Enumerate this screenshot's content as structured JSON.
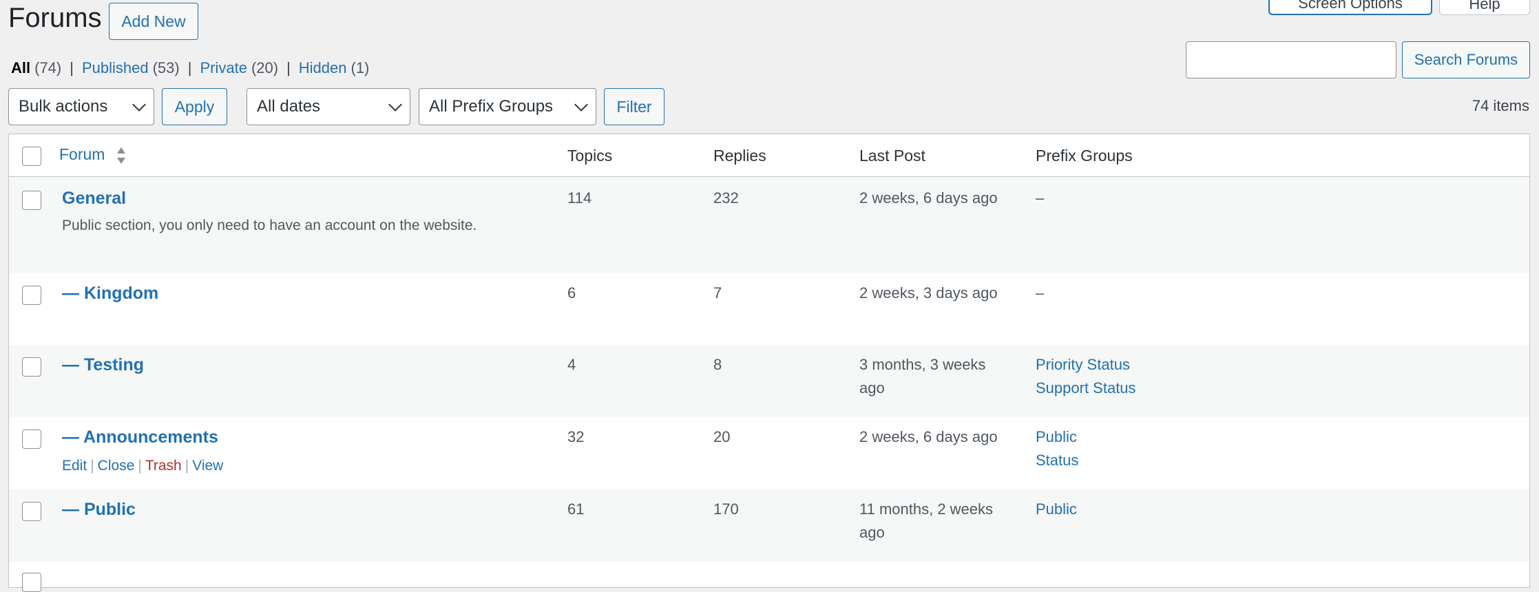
{
  "header": {
    "title": "Forums",
    "add_new": "Add New",
    "screen_options": "Screen Options",
    "help": "Help"
  },
  "views": [
    {
      "label": "All",
      "count": "(74)"
    },
    {
      "label": "Published",
      "count": "(53)"
    },
    {
      "label": "Private",
      "count": "(20)"
    },
    {
      "label": "Hidden",
      "count": "(1)"
    }
  ],
  "search": {
    "placeholder": "",
    "button": "Search Forums"
  },
  "tablenav": {
    "bulk_actions": "Bulk actions",
    "apply": "Apply",
    "dates": "All dates",
    "prefix_groups": "All Prefix Groups",
    "filter": "Filter",
    "items_count": "74 items"
  },
  "columns": {
    "forum": "Forum",
    "topics": "Topics",
    "replies": "Replies",
    "last_post": "Last Post",
    "prefix_groups": "Prefix Groups"
  },
  "rows": [
    {
      "title": "General",
      "description": "Public section, you only need to have an account on the website.",
      "topics": "114",
      "replies": "232",
      "last_post": "2 weeks, 6 days ago",
      "prefix_groups": [
        "–"
      ]
    },
    {
      "title": "— Kingdom",
      "topics": "6",
      "replies": "7",
      "last_post": "2 weeks, 3 days ago",
      "prefix_groups": [
        "–"
      ]
    },
    {
      "title": "— Testing",
      "topics": "4",
      "replies": "8",
      "last_post": "3 months, 3 weeks ago",
      "prefix_groups": [
        "Priority Status",
        "Support Status"
      ]
    },
    {
      "title": "— Announcements",
      "topics": "32",
      "replies": "20",
      "last_post": "2 weeks, 6 days ago",
      "prefix_groups": [
        "Public",
        "Status"
      ]
    },
    {
      "title": "— Public",
      "topics": "61",
      "replies": "170",
      "last_post": "11 months, 2 weeks ago",
      "prefix_groups": [
        "Public"
      ]
    }
  ],
  "row_actions": {
    "edit": "Edit",
    "close": "Close",
    "trash": "Trash",
    "view": "View"
  }
}
